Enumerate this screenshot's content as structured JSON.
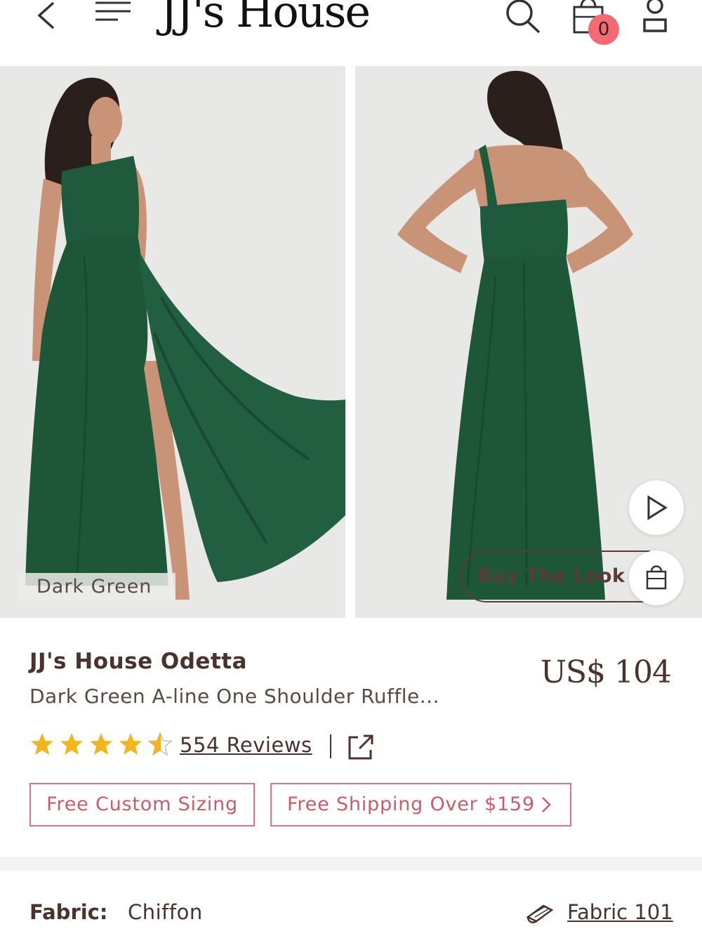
{
  "header": {
    "logo": "JJ's House",
    "cart_count": "0"
  },
  "gallery": {
    "color_label": "Dark Green",
    "buy_the_look": "Buy The Look"
  },
  "product": {
    "brand_name": "JJ's House Odetta",
    "title": "Dark Green A-line One Shoulder Ruffle...",
    "price": "US$ 104",
    "rating": 4.5,
    "reviews_label": "554 Reviews"
  },
  "badges": {
    "custom_sizing": "Free Custom Sizing",
    "free_shipping": "Free Shipping Over $159"
  },
  "details": {
    "fabric_label": "Fabric:",
    "fabric_value": "Chiffon",
    "fabric_link": "Fabric 101"
  },
  "colors": {
    "dress_green": "#1f5a3c",
    "badge_pink": "#d97780",
    "cart_badge": "#f36a74",
    "star_gold": "#f2b51f"
  },
  "icons": [
    "back-icon",
    "menu-icon",
    "search-icon",
    "bag-icon",
    "user-icon",
    "play-icon",
    "shopping-bag-icon",
    "star-icon",
    "share-icon",
    "fabric-icon",
    "chevron-right-icon"
  ]
}
